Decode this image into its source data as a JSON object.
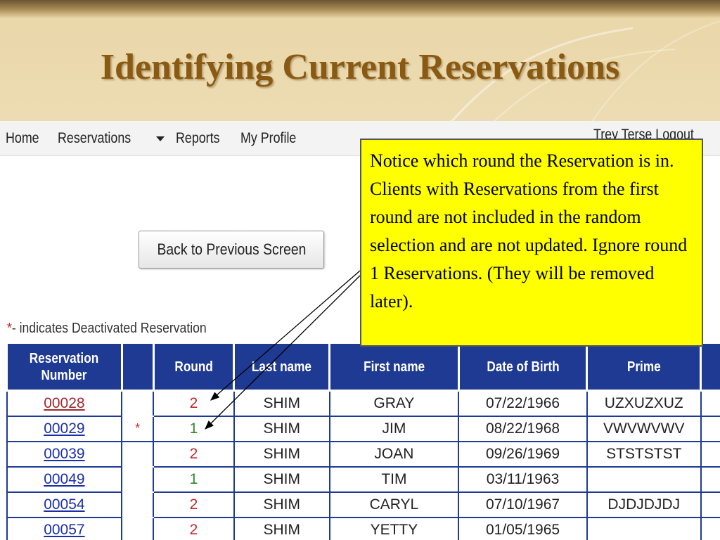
{
  "slide": {
    "title": "Identifying Current Reservations"
  },
  "navbar": {
    "home": "Home",
    "reservations": "Reservations",
    "reports": "Reports",
    "my_profile": "My Profile",
    "user_name": "Trey Terse",
    "logout": "Logout"
  },
  "back_button": "Back to Previous Screen",
  "legend": {
    "star": "*",
    "text": "- indicates Deactivated Reservation"
  },
  "table": {
    "headers": [
      "Reservation Number",
      "",
      "Round",
      "Last name",
      "First name",
      "Date of Birth",
      "Prime"
    ],
    "rows": [
      {
        "number": "00028",
        "deactivated": "",
        "round": "2",
        "last": "SHIM",
        "first": "GRAY",
        "dob": "07/22/1966",
        "prime": "UZXUZXUZ"
      },
      {
        "number": "00029",
        "deactivated": "*",
        "round": "1",
        "last": "SHIM",
        "first": "JIM",
        "dob": "08/22/1968",
        "prime": "VWVWVWV"
      },
      {
        "number": "00039",
        "deactivated": "",
        "round": "2",
        "last": "SHIM",
        "first": "JOAN",
        "dob": "09/26/1969",
        "prime": "STSTSTST"
      },
      {
        "number": "00049",
        "deactivated": "",
        "round": "1",
        "last": "SHIM",
        "first": "TIM",
        "dob": "03/11/1963",
        "prime": ""
      },
      {
        "number": "00054",
        "deactivated": "",
        "round": "2",
        "last": "SHIM",
        "first": "CARYL",
        "dob": "07/10/1967",
        "prime": "DJDJDJDJ"
      },
      {
        "number": "00057",
        "deactivated": "",
        "round": "2",
        "last": "SHIM",
        "first": "YETTY",
        "dob": "01/05/1965",
        "prime": ""
      }
    ]
  },
  "callout": {
    "text": "Notice which round the Reservation is in. Clients with Reservations from the first round are not included in the random selection and are not updated. Ignore round 1 Reservations. (They will be removed later)."
  },
  "colors": {
    "title": "#8a5a12",
    "header_bg": "#1f3a93",
    "round_2": "#c0282d",
    "round_1": "#2a8a2a",
    "callout_bg": "#ffff00"
  }
}
